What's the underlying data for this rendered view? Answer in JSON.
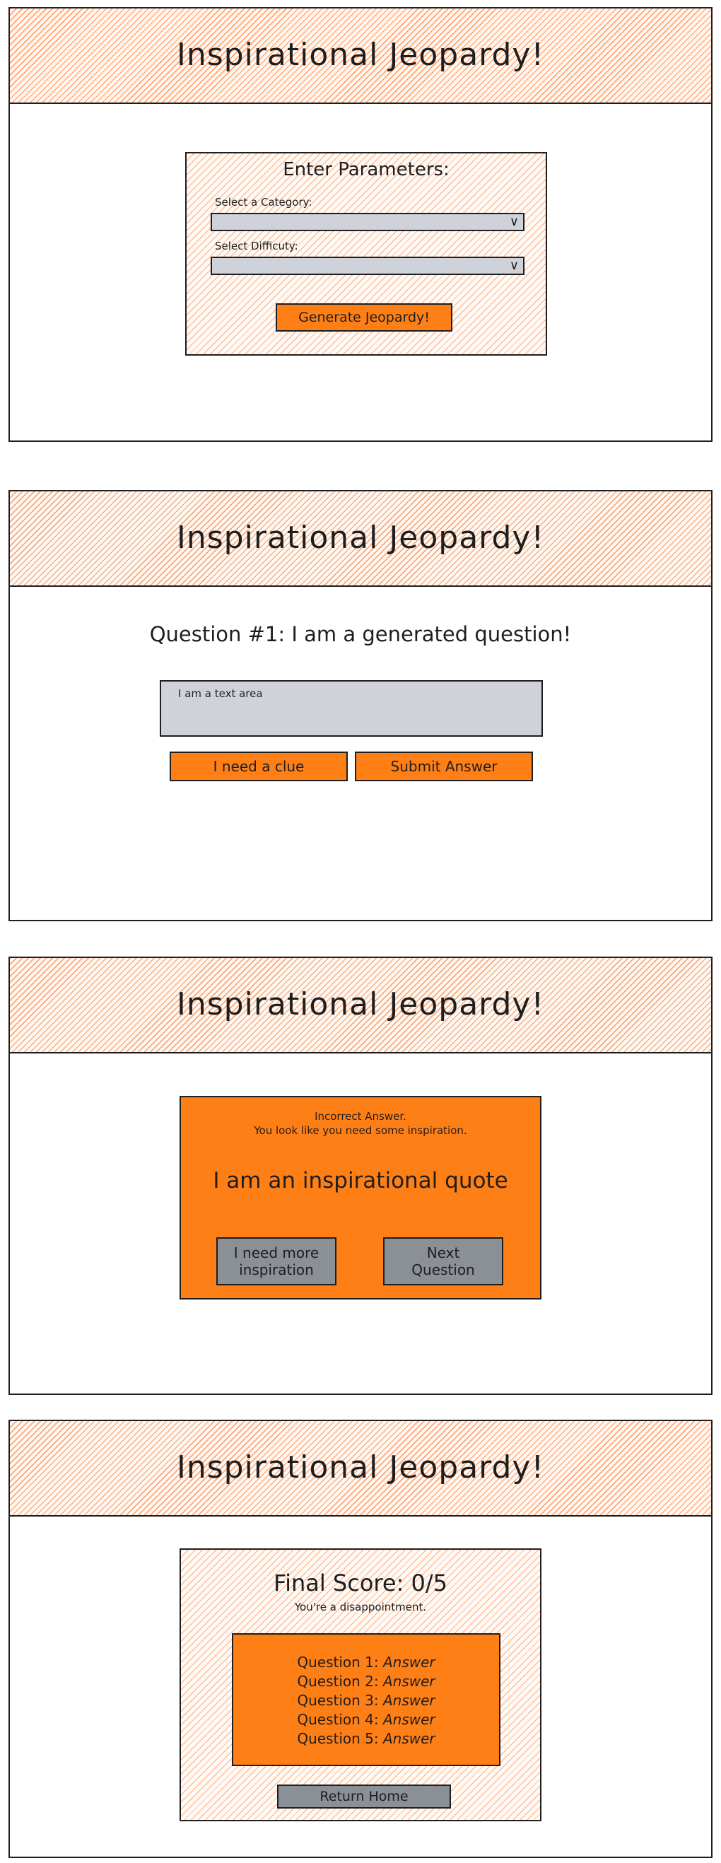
{
  "app_title": "Inspirational Jeopardy!",
  "screen1": {
    "panel_title": "Enter Parameters:",
    "category_label": "Select a Category:",
    "difficulty_label": "Select Difficuty:",
    "generate_button": "Generate Jeopardy!"
  },
  "screen2": {
    "question": "Question #1: I am a generated question!",
    "textarea_placeholder": "I am a text area",
    "clue_button": "I need a clue",
    "submit_button": "Submit Answer"
  },
  "screen3": {
    "result_line1": "Incorrect Answer.",
    "result_line2": "You look like you need some inspiration.",
    "quote": "I am an inspirational quote",
    "more_inspiration_button": "I need more inspiration",
    "next_question_button": "Next Question"
  },
  "screen4": {
    "final_score": "Final Score: 0/5",
    "subtitle": "You're a disappointment.",
    "answers": [
      {
        "label": "Question 1:",
        "value": "Answer"
      },
      {
        "label": "Question 2:",
        "value": "Answer"
      },
      {
        "label": "Question 3:",
        "value": "Answer"
      },
      {
        "label": "Question 4:",
        "value": "Answer"
      },
      {
        "label": "Question 5:",
        "value": "Answer"
      }
    ],
    "return_button": "Return Home"
  },
  "colors": {
    "accent_orange": "#ff7f17",
    "input_grey": "#cfd3d9",
    "button_grey": "#8b9096",
    "hatch_orange": "#ff9155"
  }
}
